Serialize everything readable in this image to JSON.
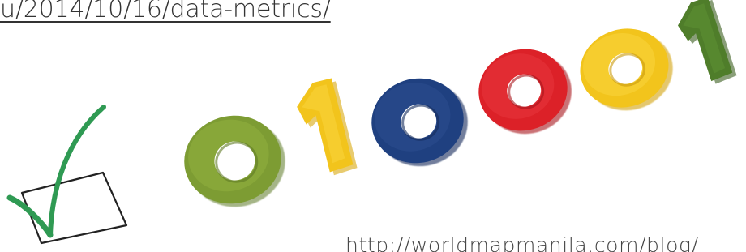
{
  "top_caption": {
    "text": "u/2014/10/16/data-metrics/"
  },
  "bottom_caption": {
    "text": "http://worldmapmanila.com/blog/"
  },
  "illustration": {
    "digits": [
      "0",
      "1",
      "0",
      "0",
      "0",
      "1"
    ],
    "digit_colors": [
      "#7a9b32",
      "#f1c31b",
      "#1f3f7d",
      "#d92027",
      "#f1c31b",
      "#4f7d2a"
    ],
    "check_color": "#2f9a53",
    "box_stroke": "#222222"
  }
}
